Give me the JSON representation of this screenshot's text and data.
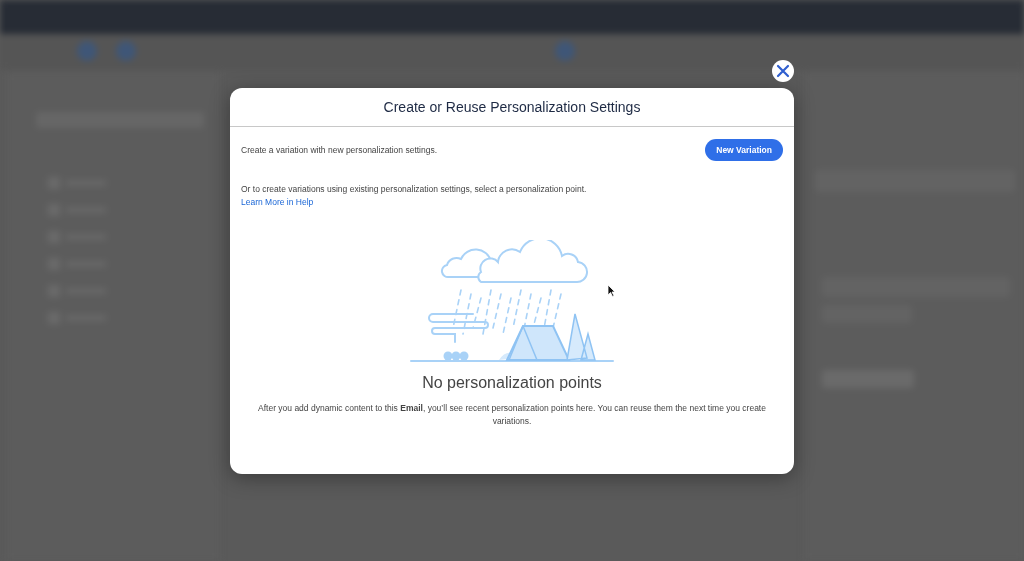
{
  "dialog": {
    "title": "Create or Reuse Personalization Settings",
    "intro": "Create a variation with new personalization settings.",
    "primary_button": "New Variation",
    "reuse_text": "Or to create variations using existing personalization settings, select a personalization point.",
    "help_link": "Learn More in Help",
    "empty_title": "No personalization points",
    "empty_text": "After you add dynamic content to this **Email**, you’ll see recent personalization points here. You can reuse them the next time you create variations."
  }
}
